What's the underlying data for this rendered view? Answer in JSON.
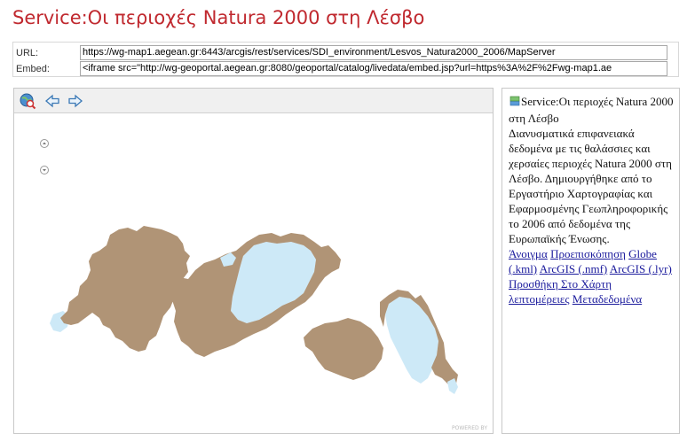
{
  "page": {
    "title": "Service:Οι περιοχές Natura 2000 στη Λέσβο"
  },
  "urlbox": {
    "url_label": "URL:",
    "url_value": "https://wg-map1.aegean.gr:6443/arcgis/rest/services/SDI_environment/Lesvos_Natura2000_2006/MapServer",
    "embed_label": "Embed:",
    "embed_value": "<iframe src=\"http://wg-geoportal.aegean.gr:8080/geoportal/catalog/livedata/embed.jsp?url=https%3A%2F%2Fwg-map1.ae"
  },
  "map": {
    "toolbar_icons": [
      "globe-search-icon",
      "back-arrow-icon",
      "forward-arrow-icon"
    ],
    "zoom_in_icon": "zoom-in-icon",
    "zoom_out_icon": "zoom-out-icon",
    "powered_by": "POWERED BY",
    "colors": {
      "land": "#b09476",
      "water": "#cde9f7"
    }
  },
  "info": {
    "service_title": "Service:Οι περιοχές Natura 2000 στη Λέσβο",
    "description": "Διανυσματικά επιφανειακά δεδομένα με τις θαλάσσιες και χερσαίες περιοχές Natura 2000 στη Λέσβο. Δημιουργήθηκε από το Εργαστήριο Χαρτογραφίας και Εφαρμοσμένης Γεωπληροφορικής το 2006 από δεδομένα της Ευρωπαϊκής Ένωσης.",
    "links": {
      "open": "Άνοιγμα",
      "preview": "Προεπισκόπηση",
      "globe_kml": "Globe (.kml)",
      "arcgis_nmf": "ArcGIS (.nmf)",
      "arcgis_lyr": "ArcGIS (.lyr)",
      "add_to_map": "Προσθήκη Στο Χάρτη",
      "details": "λεπτομέρειες",
      "metadata": "Μεταδεδομένα"
    }
  }
}
